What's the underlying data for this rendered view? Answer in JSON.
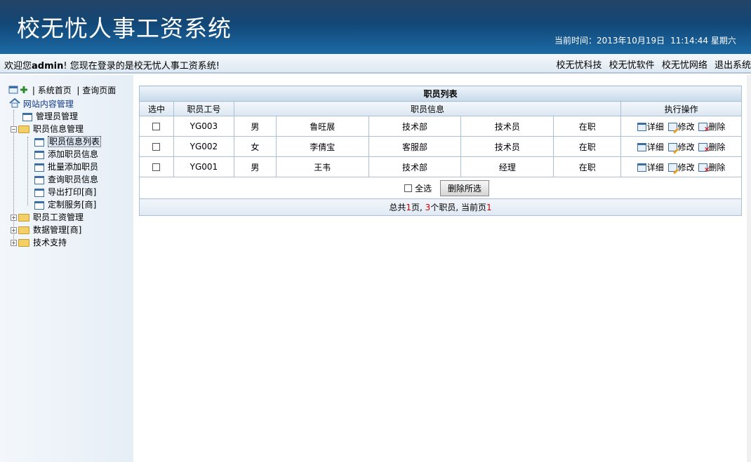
{
  "header": {
    "app_title": "校无忧人事工资系统",
    "time_label": "当前时间：",
    "date": "2013年10月19日",
    "time": "11:14:44",
    "weekday": "星期六"
  },
  "welcome": {
    "prefix": "欢迎您",
    "user": "admin",
    "suffix": "! 您现在登录的是校无忧人事工资系统!"
  },
  "top_links": [
    "校无忧科技",
    "校无忧软件",
    "校无忧网络",
    "退出系统"
  ],
  "sidebar": {
    "home_label": "系统首页",
    "query_label": "查询页面",
    "root_label": "网站内容管理",
    "admin_label": "管理员管理",
    "staff_info_label": "职员信息管理",
    "staff_children": [
      "职员信息列表",
      "添加职员信息",
      "批量添加职员",
      "查询职员信息",
      "导出打印[商]",
      "定制服务[商]"
    ],
    "salary_label": "职员工资管理",
    "data_label": "数据管理[商]",
    "support_label": "技术支持"
  },
  "table": {
    "caption": "职员列表",
    "col_select": "选中",
    "col_id": "职员工号",
    "col_info": "职员信息",
    "col_ops": "执行操作",
    "rows": [
      {
        "id": "YG003",
        "gender": "男",
        "name": "鲁旺展",
        "dept": "技术部",
        "role": "技术员",
        "status": "在职"
      },
      {
        "id": "YG002",
        "gender": "女",
        "name": "李倩宝",
        "dept": "客服部",
        "role": "技术员",
        "status": "在职"
      },
      {
        "id": "YG001",
        "gender": "男",
        "name": "王韦",
        "dept": "技术部",
        "role": "经理",
        "status": "在职"
      }
    ],
    "op_detail": "详细",
    "op_edit": "修改",
    "op_delete": "删除",
    "select_all": "全选",
    "delete_selected": "删除所选"
  },
  "pager": {
    "prefix": "总共",
    "pages": "1",
    "pages_unit": "页,",
    "count": "3",
    "count_unit": "个职员,",
    "current_label": "当前页",
    "current": "1"
  }
}
